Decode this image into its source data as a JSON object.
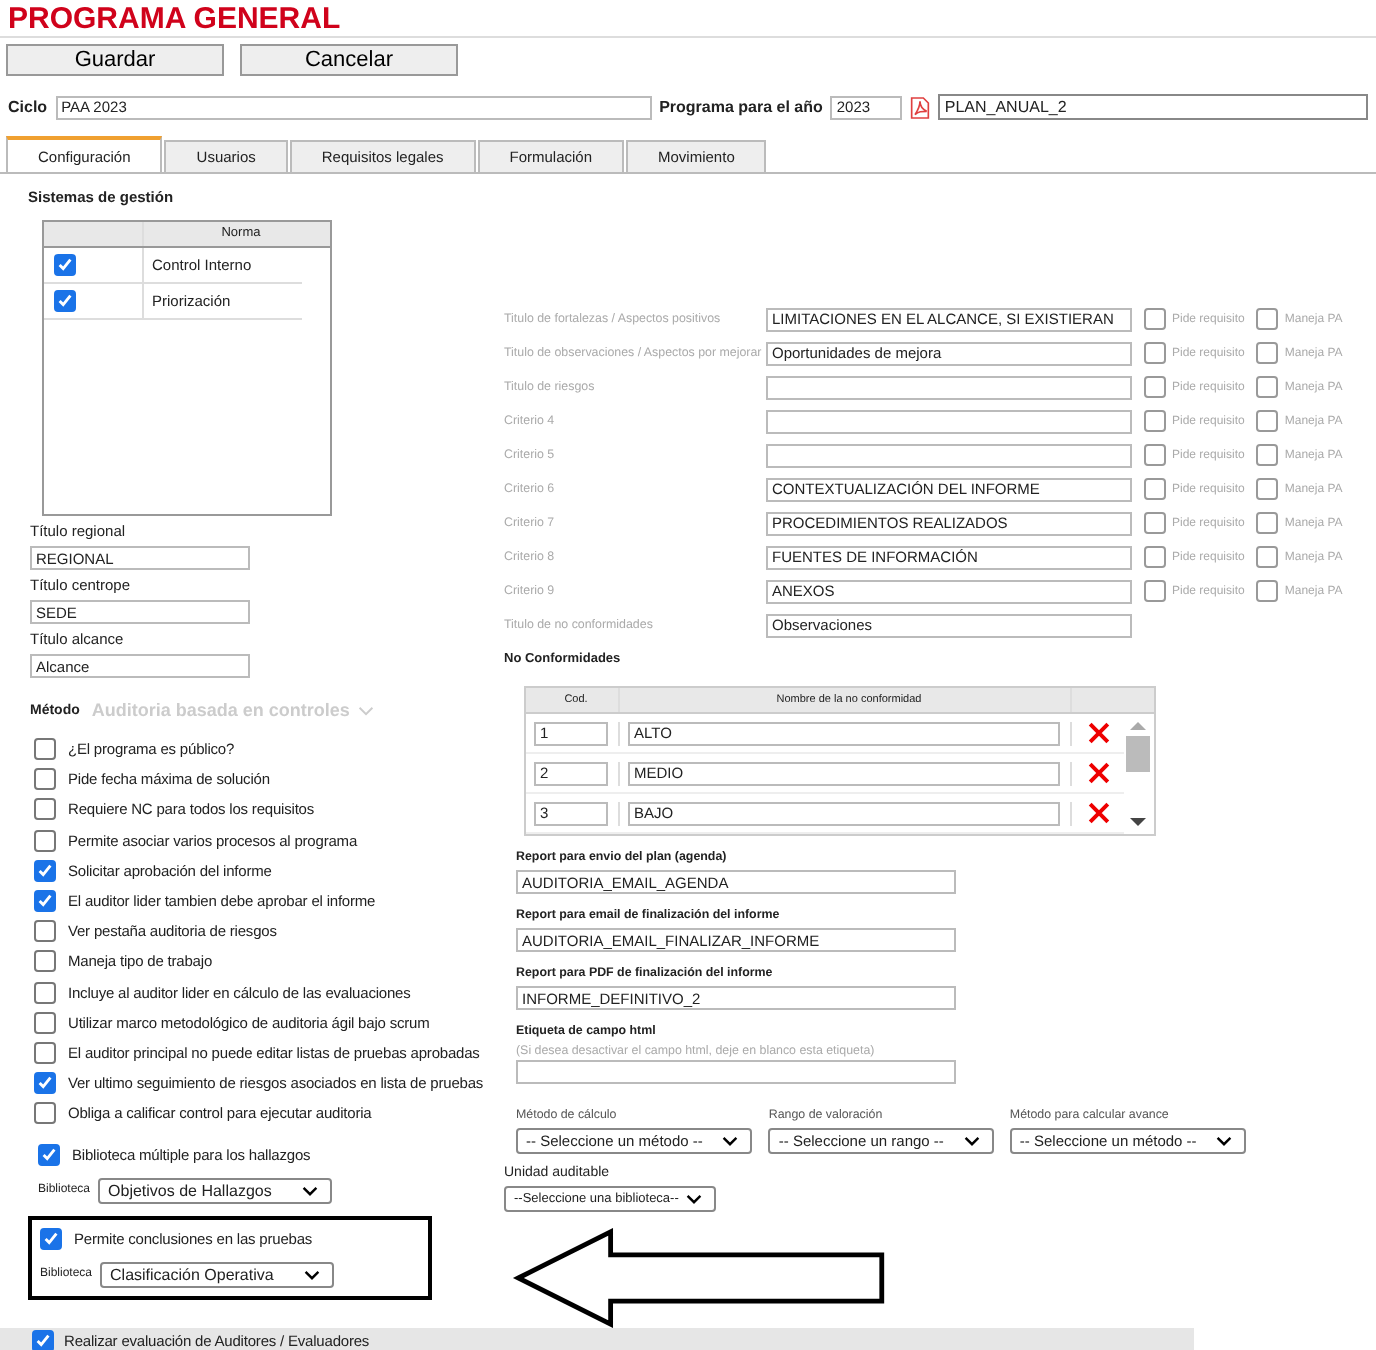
{
  "title": "PROGRAMA GENERAL",
  "buttons": [
    "Guardar",
    "Cancelar"
  ],
  "cycle": {
    "label": "Ciclo",
    "value": "PAA 2023",
    "year_label": "Programa para el año",
    "year": "2023",
    "report": "PLAN_ANUAL_2"
  },
  "tabs": [
    {
      "label": "Configuración",
      "selected": true
    },
    {
      "label": "Usuarios",
      "selected": false
    },
    {
      "label": "Requisitos legales",
      "selected": false
    },
    {
      "label": "Formulación",
      "selected": false
    },
    {
      "label": "Movimiento",
      "selected": false
    }
  ],
  "management_systems": {
    "title": "Sistemas de gestión",
    "column": "Norma",
    "rows": [
      {
        "name": "Control Interno",
        "checked": true
      },
      {
        "name": "Priorización",
        "checked": true
      }
    ]
  },
  "title_fields": [
    {
      "label": "Título regional",
      "value": "REGIONAL"
    },
    {
      "label": "Título centrope",
      "value": "SEDE"
    },
    {
      "label": "Título alcance",
      "value": "Alcance"
    }
  ],
  "method": {
    "label": "Método",
    "value": "Auditoria basada en controles",
    "disabled": true
  },
  "options": [
    {
      "label": "¿El programa es público?",
      "checked": false
    },
    {
      "label": "Pide fecha máxima de solución",
      "checked": false
    },
    {
      "label": "Requiere NC para todos los requisitos",
      "checked": false
    },
    {
      "label": "Permite asociar varios procesos al programa",
      "checked": false
    },
    {
      "label": "Solicitar aprobación del informe",
      "checked": true
    },
    {
      "label": "El auditor lider tambien debe aprobar el informe",
      "checked": true
    },
    {
      "label": "Ver pestaña auditoria de riesgos",
      "checked": false
    },
    {
      "label": "Maneja tipo de trabajo",
      "checked": false
    },
    {
      "label": "Incluye al auditor lider en cálculo de las evaluaciones",
      "checked": false
    },
    {
      "label": "Utilizar marco metodológico de auditoria ágil bajo scrum",
      "checked": false
    },
    {
      "label": "El auditor principal no puede editar listas de pruebas aprobadas",
      "checked": false
    },
    {
      "label": "Ver ultimo seguimiento de riesgos asociados en lista de pruebas",
      "checked": true
    },
    {
      "label": "Obliga a calificar control para ejecutar auditoria",
      "checked": false
    }
  ],
  "library_groups": [
    {
      "label": "Biblioteca múltiple para los hallazgos",
      "checked": true,
      "library_label": "Biblioteca",
      "library": "Objetivos de Hallazgos",
      "highlighted": false
    },
    {
      "label": "Permite conclusiones en las pruebas",
      "checked": true,
      "library_label": "Biblioteca",
      "library": "Clasificación Operativa",
      "highlighted": true
    }
  ],
  "criteria": [
    {
      "label": "Titulo de fortalezas / Aspectos positivos",
      "value": "LIMITACIONES EN EL ALCANCE, SI EXISTIERAN",
      "requires": false,
      "requires_label": "Pide requisito",
      "pa": false,
      "pa_label": "Maneja PA"
    },
    {
      "label": "Titulo de observaciones / Aspectos por mejorar",
      "value": "Oportunidades de mejora",
      "requires": false,
      "requires_label": "Pide requisito",
      "pa": false,
      "pa_label": "Maneja PA"
    },
    {
      "label": "Titulo de riesgos",
      "requires": false,
      "requires_label": "Pide requisito",
      "pa": false,
      "pa_label": "Maneja PA"
    },
    {
      "label": "Criterio 4",
      "requires": false,
      "requires_label": "Pide requisito",
      "pa": false,
      "pa_label": "Maneja PA"
    },
    {
      "label": "Criterio 5",
      "requires": false,
      "requires_label": "Pide requisito",
      "pa": false,
      "pa_label": "Maneja PA"
    },
    {
      "label": "Criterio 6",
      "value": "CONTEXTUALIZACIÓN DEL INFORME",
      "requires": false,
      "requires_label": "Pide requisito",
      "pa": false,
      "pa_label": "Maneja PA"
    },
    {
      "label": "Criterio 7",
      "value": "PROCEDIMIENTOS REALIZADOS",
      "requires": false,
      "requires_label": "Pide requisito",
      "pa": false,
      "pa_label": "Maneja PA"
    },
    {
      "label": "Criterio 8",
      "value": "FUENTES DE INFORMACIÓN",
      "requires": false,
      "requires_label": "Pide requisito",
      "pa": false,
      "pa_label": "Maneja PA"
    },
    {
      "label": "Criterio 9",
      "value": "ANEXOS",
      "requires": false,
      "requires_label": "Pide requisito",
      "pa": false,
      "pa_label": "Maneja PA"
    }
  ],
  "nc_title": {
    "label": "Titulo de no conformidades",
    "value": "Observaciones"
  },
  "nonconformities": {
    "title": "No Conformidades",
    "columns": [
      "Cod.",
      "Nombre de la no conformidad"
    ],
    "rows": [
      {
        "code": "1",
        "name": "ALTO"
      },
      {
        "code": "2",
        "name": "MEDIO"
      },
      {
        "code": "3",
        "name": "BAJO"
      }
    ]
  },
  "reports": [
    {
      "label": "Report para envio del plan (agenda)",
      "value": "AUDITORIA_EMAIL_AGENDA"
    },
    {
      "label": "Report para email de finalización del informe",
      "value": "AUDITORIA_EMAIL_FINALIZAR_INFORME"
    },
    {
      "label": "Report para PDF de finalización del informe",
      "value": "INFORME_DEFINITIVO_2"
    }
  ],
  "html_field": {
    "label": "Etiqueta de campo html",
    "hint": "(Si desea desactivar el campo html, deje en blanco esta etiqueta)"
  },
  "selects": [
    {
      "label": "Método de cálculo",
      "value": "-- Seleccione un método --"
    },
    {
      "label": "Rango de valoración",
      "value": "-- Seleccione un rango --"
    },
    {
      "label": "Método para calcular avance",
      "value": "-- Seleccione un método --"
    }
  ],
  "auditable_unit": {
    "label": "Unidad auditable",
    "value": "--Seleccione una biblioteca--"
  },
  "footer_option": {
    "label": "Realizar evaluación de Auditores / Evaluadores",
    "checked": true
  }
}
